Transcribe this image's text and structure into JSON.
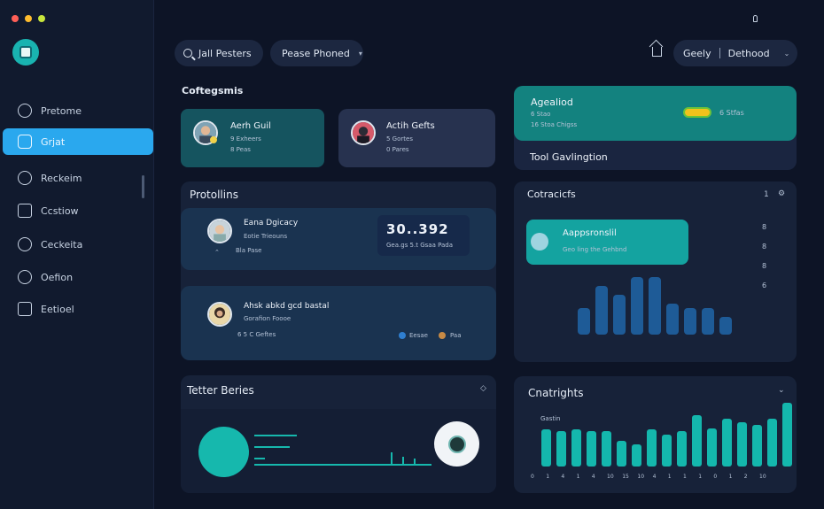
{
  "sidebar": {
    "items": [
      {
        "label": "Pretome"
      },
      {
        "label": "Grjat"
      },
      {
        "label": "Reckeim"
      },
      {
        "label": "Ccstiow"
      },
      {
        "label": "Ceckeita"
      },
      {
        "label": "Oefion"
      },
      {
        "label": "Eetioel"
      }
    ]
  },
  "topbar": {
    "search_label": "Jall Pesters",
    "filter_label": "Pease Phoned",
    "profile_name": "Geely",
    "profile_page": "Dethood"
  },
  "categories": {
    "title": "Coftegsmis",
    "cards": [
      {
        "name": "Aerh Guil",
        "sub1": "9 Exheers",
        "sub2": "8 Peas"
      },
      {
        "name": "Actih Gefts",
        "sub1": "5 Gortes",
        "sub2": "0 Pares"
      }
    ]
  },
  "applied": {
    "title": "Agealiod",
    "sub1": "6 Stao",
    "sub2": "16 Stoa Chigss",
    "badge": "6 Stfas",
    "footer": "Tool Gavlingtion"
  },
  "protellins": {
    "title": "Protollins",
    "row1": {
      "name": "Eana Dgicacy",
      "sub": "Eotie Trieouns",
      "sub2": "Bla Pase",
      "value": "30..392",
      "value_sub": "Gea.gs 5.t Gsaa Pada"
    },
    "row2": {
      "name": "Ahsk abkd gcd bastal",
      "sub": "Gorafion Foooe",
      "sub2": "6 5 C Geftes",
      "legend1": "Eesae",
      "legend2": "Paa"
    }
  },
  "contracts": {
    "title": "Cotracicfs",
    "count": "1",
    "card_title": "Aappsronslil",
    "card_sub": "Geo ling the Gehbnd",
    "axis": [
      "8",
      "8",
      "8",
      "6"
    ],
    "bars": [
      0.3,
      0.55,
      0.45,
      0.65,
      0.65,
      0.35,
      0.3,
      0.3,
      0.2
    ]
  },
  "tetter": {
    "title": "Tetter Beries"
  },
  "insights": {
    "title": "Cnatrights",
    "small_label": "Gastin",
    "bars": [
      0.58,
      0.55,
      0.58,
      0.55,
      0.55,
      0.4,
      0.35,
      0.58,
      0.5,
      0.55,
      0.8,
      0.6,
      0.75,
      0.7,
      0.65,
      0.75,
      1.0
    ],
    "ticks": [
      "0",
      "1",
      "4",
      "1",
      "4",
      "10",
      "15",
      "10",
      "4",
      "1",
      "1",
      "1",
      "0",
      "1",
      "2",
      "10"
    ]
  },
  "colors": {
    "accent": "#2aa8ee",
    "teal": "#19b3b0",
    "bar_blue": "#1e5b97",
    "bar_teal": "#14b7ad"
  }
}
